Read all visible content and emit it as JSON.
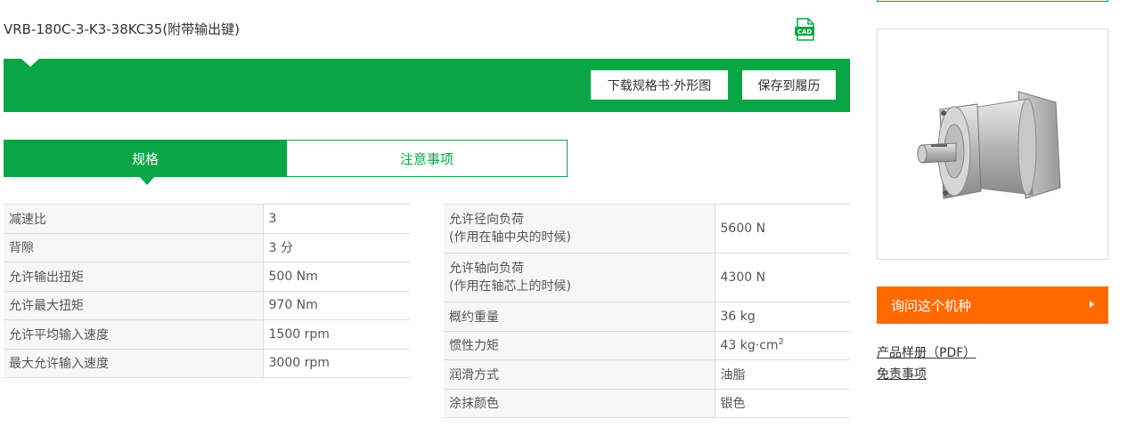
{
  "product": {
    "title": "VRB-180C-3-K3-38KC35(附带输出键)",
    "cad_icon_text": "CAD"
  },
  "toolbar": {
    "download_label": "下载规格书·外形图",
    "save_label": "保存到履历"
  },
  "tabs": [
    {
      "label": "规格",
      "active": true
    },
    {
      "label": "注意事项",
      "active": false
    }
  ],
  "spec_left": [
    {
      "label": "减速比",
      "value": "3"
    },
    {
      "label": "背隙",
      "value": "3 分"
    },
    {
      "label": "允许输出扭矩",
      "value": "500 Nm"
    },
    {
      "label": "允许最大扭矩",
      "value": "970 Nm"
    },
    {
      "label": "允许平均输入速度",
      "value": "1500 rpm"
    },
    {
      "label": "最大允许输入速度",
      "value": "3000 rpm"
    }
  ],
  "spec_right": [
    {
      "label": "允许径向负荷",
      "sublabel": "(作用在轴中央的时候)",
      "value": "5600 N"
    },
    {
      "label": "允许轴向负荷",
      "sublabel": "(作用在轴芯上的时候)",
      "value": "4300 N"
    },
    {
      "label": "概约重量",
      "value": "36 kg"
    },
    {
      "label": "惯性力矩",
      "value": "43 kg·cm",
      "value_sup": "2"
    },
    {
      "label": "润滑方式",
      "value": "油脂"
    },
    {
      "label": "涂抹颜色",
      "value": "银色"
    }
  ],
  "sidebar": {
    "inquiry_label": "询问这个机种",
    "catalog_link": "产品样册（PDF）",
    "disclaimer_link": "免责事项"
  },
  "colors": {
    "brand_green": "#0aa545",
    "inquiry_orange": "#ff6a00"
  }
}
